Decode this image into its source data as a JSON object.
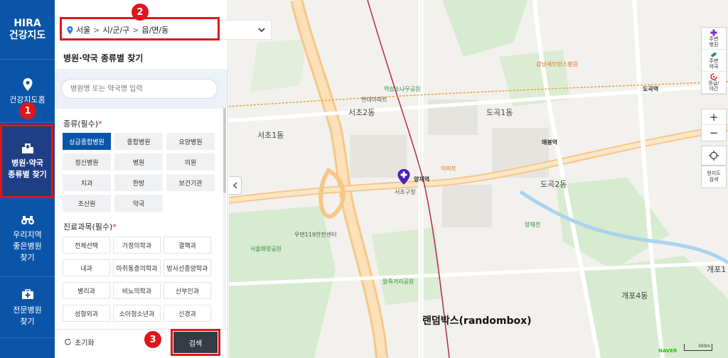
{
  "rail": {
    "logo_line1": "HIRA",
    "logo_line2": "건강지도",
    "items": [
      {
        "label": "건강지도홈",
        "icon": "location-pin-icon"
      },
      {
        "label": "병원·약국 종류별 찾기",
        "label1": "병원·약국",
        "label2": "종류별 찾기",
        "icon": "hospital-building-icon"
      },
      {
        "label": "우리지역 좋은병원 찾기",
        "label1": "우리지역",
        "label2": "좋은병원",
        "label3": "찾기",
        "icon": "binoculars-icon"
      },
      {
        "label": "전문병원 찾기",
        "label1": "전문병원",
        "label2": "찾기",
        "icon": "specialist-hospital-icon"
      }
    ]
  },
  "panel": {
    "location": {
      "sido": "서울",
      "sigungu": "시/군/구",
      "dong": "읍/면/동",
      "sep": ">"
    },
    "title": "병원·약국 종류별 찾기",
    "search_placeholder": "병원명 또는 약국명 입력",
    "type_label": "종류(필수)",
    "type_req": "*",
    "types": [
      "상급종합병원",
      "종합병원",
      "요양병원",
      "정신병원",
      "병원",
      "의원",
      "치과",
      "한방",
      "보건기관",
      "조산원",
      "약국"
    ],
    "selected_type": "상급종합병원",
    "dept_label": "진료과목(필수)",
    "dept_req": "*",
    "departments": [
      "전체선택",
      "가정의학과",
      "결핵과",
      "내과",
      "마취통증의학과",
      "방사선종양학과",
      "병리과",
      "비뇨의학과",
      "산부인과",
      "성형외과",
      "소아청소년과",
      "신경과"
    ],
    "reset_label": "초기화",
    "search_button": "검색"
  },
  "map": {
    "labels": {
      "seocho1": "서초1동",
      "seocho2": "서초2동",
      "dogok1": "도곡1동",
      "dogok2": "도곡2동",
      "gaepo4": "개포4동",
      "gaepo1": "개포1",
      "yangjae_station": "양재역",
      "maebong_station": "매봉역",
      "dogok_station": "도곡역",
      "seocho_office": "서초구청",
      "yangjaecheon": "양재천",
      "yeoksam_park": "역삼소나무공원",
      "seoul_yangjae_park": "서울화양공원",
      "gangnam_severance": "강남세브란스병원",
      "hyundai_apt": "현대아파트",
      "emart": "이마트",
      "woomyeon_119": "우면119안전센터",
      "mal_park": "말죽거리공원",
      "naver": "NAVER",
      "scale": "300m"
    },
    "watermark": "랜덤박스(randombox)",
    "tools": [
      {
        "label1": "주변",
        "label2": "병원",
        "icon": "hospital-plus-icon",
        "color": "#7b2fd6"
      },
      {
        "label1": "주변",
        "label2": "약국",
        "icon": "pharmacy-pill-icon",
        "color": "#17a34a"
      },
      {
        "label1": "응급/",
        "label2": "야간",
        "icon": "emergency-icon",
        "color": "#e0262b"
      }
    ],
    "zoom_in": "+",
    "zoom_out": "−",
    "nearby_search_line1": "현지도",
    "nearby_search_line2": "검색"
  },
  "annotations": [
    "1",
    "2",
    "3"
  ],
  "colors": {
    "primary": "#0b55a8",
    "rail_active": "#1e3f86",
    "annotation": "#e0151c",
    "search_button": "#333c45"
  }
}
